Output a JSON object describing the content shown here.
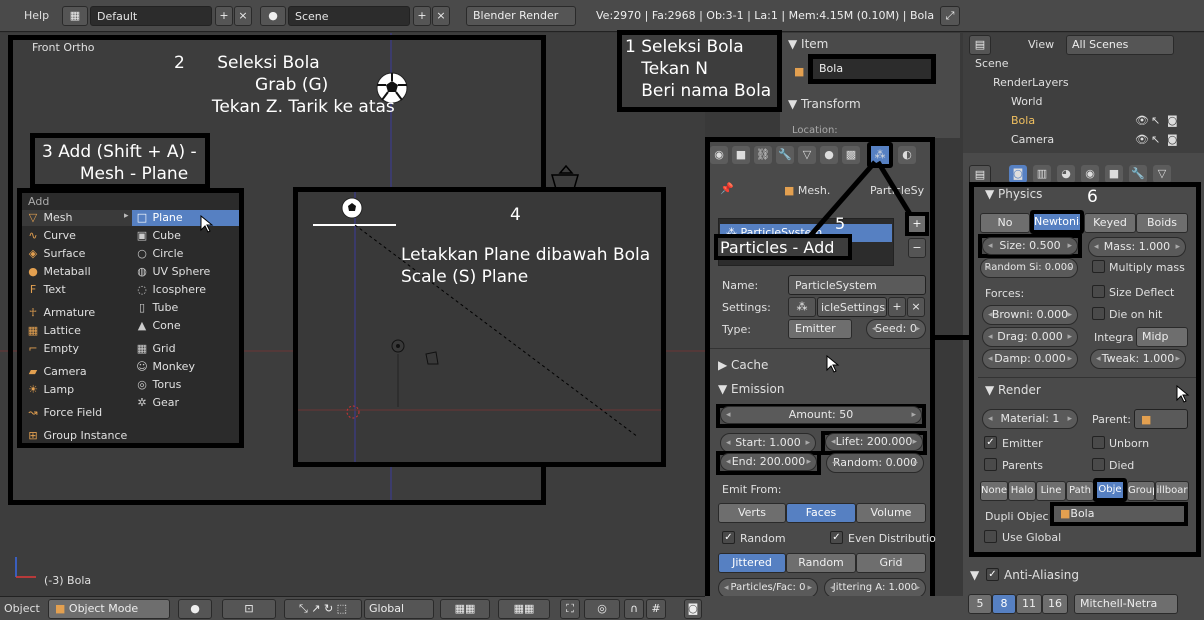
{
  "topbar": {
    "menu_help": "Help",
    "layout": "Default",
    "scene": "Scene",
    "engine": "Blender Render",
    "stats": "Ve:2970 | Fa:2968 | Ob:3-1 | La:1 | Mem:4.15M (0.10M) | Bola"
  },
  "viewport": {
    "view_label": "Front Ortho",
    "object_label": "(-3) Bola"
  },
  "annotations": {
    "a1": "1 Seleksi Bola\n   Tekan N\n   Beri nama Bola",
    "a2": "2      Seleksi Bola\n               Grab (G)\n       Tekan Z. Tarik ke atas",
    "a3": "3 Add (Shift + A) -\n       Mesh - Plane",
    "a4": "4",
    "a4text": "Letakkan Plane dibawah Bola\nScale (S) Plane",
    "a5": "5",
    "a5text": "Particles - Add",
    "a6": "6"
  },
  "add_menu": {
    "title": "Add",
    "left": [
      "Mesh",
      "Curve",
      "Surface",
      "Metaball",
      "Text",
      "Armature",
      "Lattice",
      "Empty",
      "Camera",
      "Lamp",
      "Force Field",
      "Group Instance"
    ],
    "right": [
      "Plane",
      "Cube",
      "Circle",
      "UV Sphere",
      "Icosphere",
      "Tube",
      "Cone",
      "Grid",
      "Monkey",
      "Torus",
      "Gear"
    ]
  },
  "npanel": {
    "item_header": "Item",
    "object_name": "Bola",
    "transform_header": "Transform",
    "location_label": "Location:"
  },
  "outliner": {
    "view": "View",
    "scope": "All Scenes",
    "items": [
      "Scene",
      "RenderLayers",
      "World",
      "Bola",
      "Camera"
    ]
  },
  "particles": {
    "breadcrumb_mesh": "Mesh.",
    "breadcrumb_ps": "ParticleSy",
    "list_item": "ParticleSystem",
    "name_label": "Name:",
    "name_value": "ParticleSystem",
    "settings_label": "Settings:",
    "settings_value": "icleSettings",
    "type_label": "Type:",
    "type_value": "Emitter",
    "seed": "Seed: 0",
    "cache": "Cache",
    "emission": "Emission",
    "amount": "Amount: 50",
    "start": "Start: 1.000",
    "lifetime": "Lifet: 200.000",
    "end": "End: 200.000",
    "random": "Random: 0.000",
    "emit_from": "Emit From:",
    "verts": "Verts",
    "faces": "Faces",
    "volume": "Volume",
    "random_cb": "Random",
    "even_cb": "Even Distributio",
    "jittered": "Jittered",
    "random_btn": "Random",
    "grid_btn": "Grid",
    "particles_face": "Particles/Fac: 0",
    "jittering": "Jittering A: 1.000"
  },
  "physics": {
    "header": "Physics",
    "types": [
      "No",
      "Newtonian",
      "Keyed",
      "Boids"
    ],
    "size": "Size: 0.500",
    "mass": "Mass: 1.000",
    "random_size": "Random Si: 0.000",
    "multiply_mass": "Multiply mass",
    "forces": "Forces:",
    "size_deflect": "Size Deflect",
    "brownian": "Browni: 0.000",
    "die_on_hit": "Die on hit",
    "drag": "Drag: 0.000",
    "integration": "Integra",
    "integ_value": "Midp",
    "damp": "Damp: 0.000",
    "tweak": "Tweak: 1.000",
    "render_header": "Render",
    "material": "Material: 1",
    "parent": "Parent:",
    "emitter": "Emitter",
    "unborn": "Unborn",
    "parents": "Parents",
    "died": "Died",
    "render_types": [
      "None",
      "Halo",
      "Line",
      "Path",
      "Obje",
      "Group",
      "illboar"
    ],
    "dupli_label": "Dupli Objec",
    "dupli_value": "Bola",
    "use_global": "Use Global",
    "aa_header": "Anti-Aliasing",
    "aa_samples": [
      "5",
      "8",
      "11",
      "16"
    ],
    "aa_filter": "Mitchell-Netra"
  },
  "bottombar": {
    "object": "Object",
    "mode": "Object Mode",
    "orientation": "Global"
  }
}
